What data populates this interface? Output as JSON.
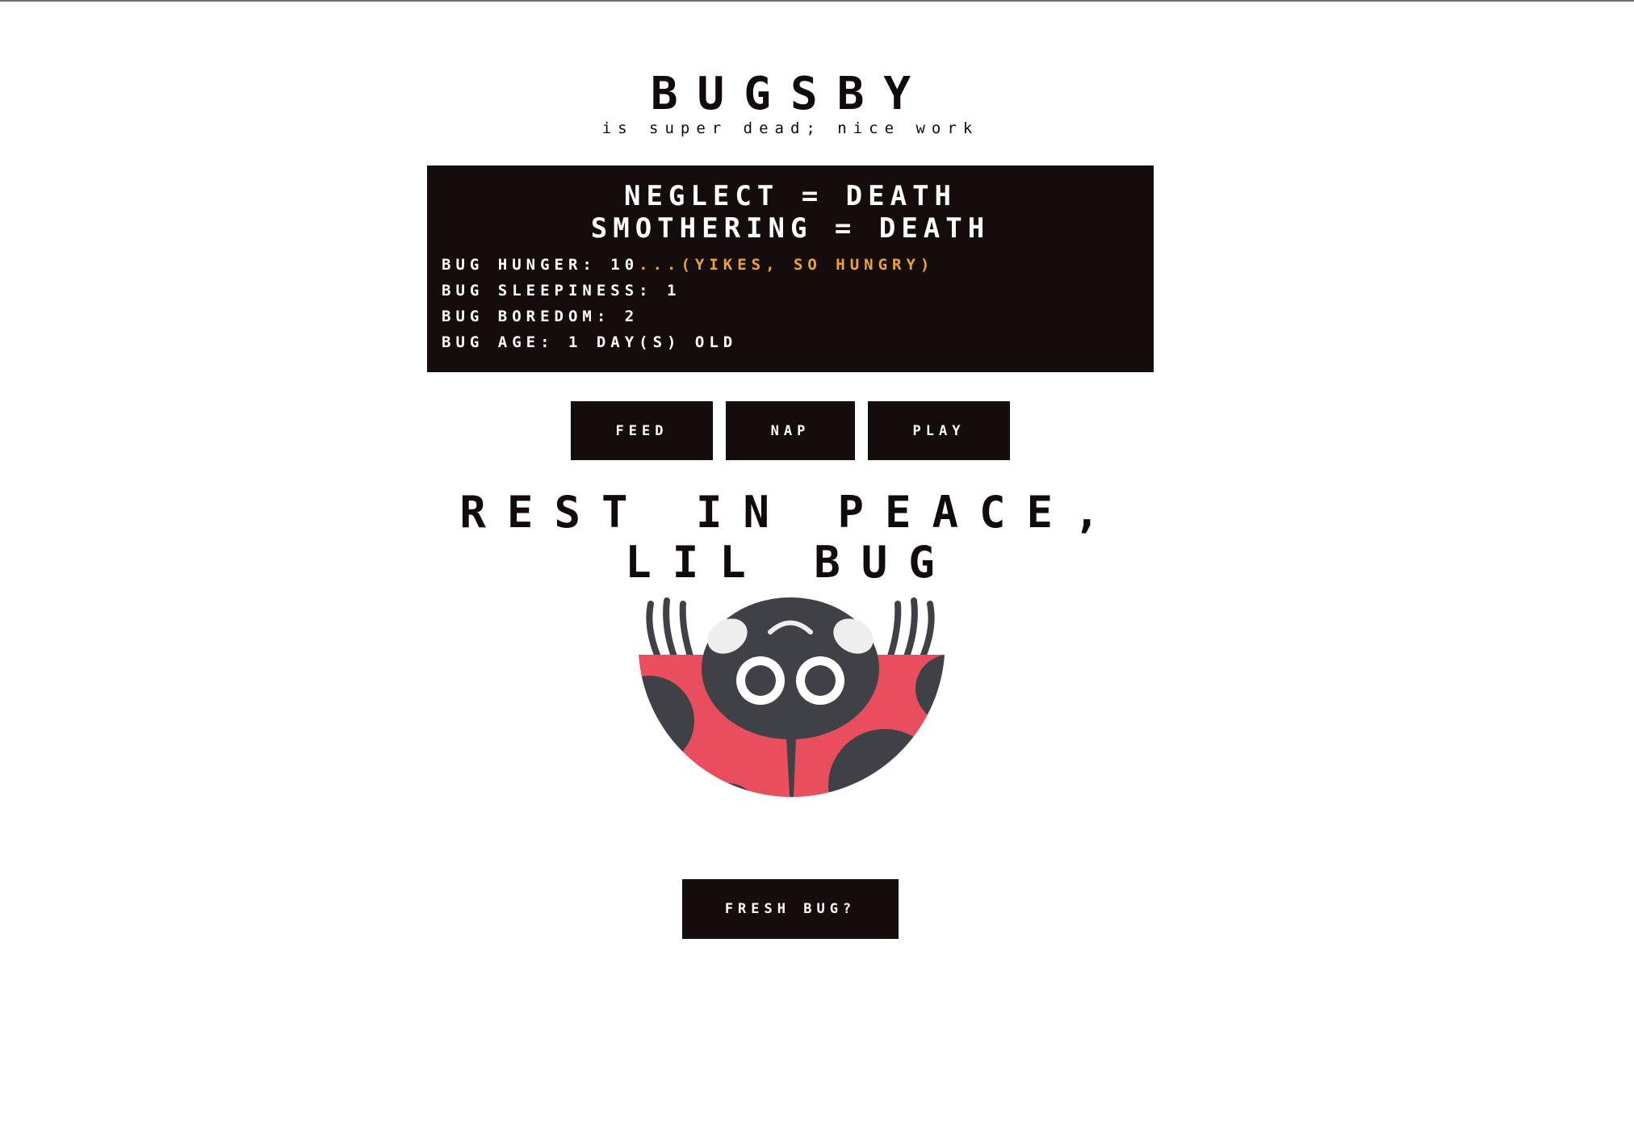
{
  "app": {
    "title": "BUGSBY",
    "subtitle": "is super dead; nice work"
  },
  "panel": {
    "rule_1": "NEGLECT = DEATH",
    "rule_2": "SMOTHERING = DEATH",
    "hunger_label": "BUG HUNGER: 10",
    "hunger_warning": "...(YIKES, SO HUNGRY)",
    "sleepiness": "BUG SLEEPINESS: 1",
    "boredom": "BUG BOREDOM: 2",
    "age": "BUG AGE: 1 DAY(S) OLD"
  },
  "actions": {
    "feed_label": "FEED",
    "nap_label": "NAP",
    "play_label": "PLAY"
  },
  "death": {
    "line_1": "REST IN PEACE,",
    "line_2": "LIL BUG",
    "reset_label": "FRESH BUG?"
  },
  "colors": {
    "panel_bg": "#150c0c",
    "warning": "#f0a330",
    "bug_red": "#e94e5e",
    "bug_dark": "#3f4146"
  },
  "icons": {
    "bug": "upside-down-ladybug-icon"
  }
}
